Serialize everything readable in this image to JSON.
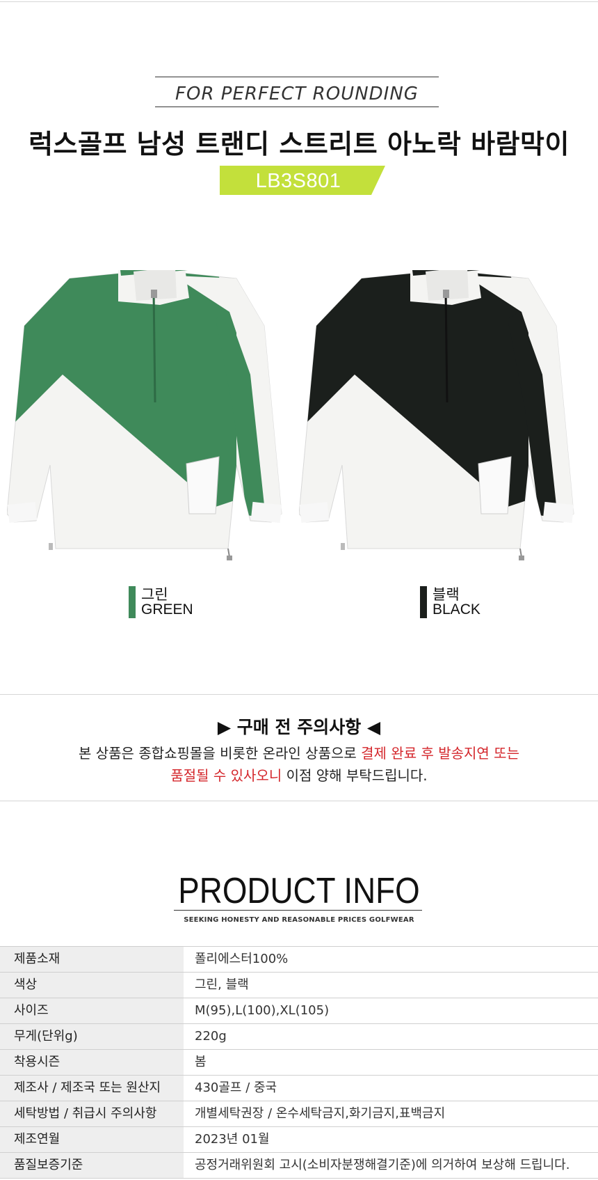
{
  "header": {
    "tagline": "FOR PERFECT ROUNDING",
    "title": "럭스골프 남성 트랜디 스트리트 아노락 바람막이",
    "product_code": "LB3S801",
    "badge_color": "#c3e03b"
  },
  "colors": [
    {
      "name_kr": "그린",
      "name_en": "GREEN",
      "swatch": "#3f8a5a"
    },
    {
      "name_kr": "블랙",
      "name_en": "BLACK",
      "swatch": "#1b1f1c"
    }
  ],
  "notice": {
    "title": "▶ 구매 전 주의사항 ◀",
    "line1_normal": "본 상품은 종합쇼핑몰을 비롯한 온라인 상품으로 ",
    "line1_red": "결제 완료 후 발송지연 또는",
    "line2_red": "품절될 수 있사오니",
    "line2_normal": " 이점 양해 부탁드립니다."
  },
  "product_info": {
    "title": "PRODUCT INFO",
    "subtitle": "SEEKING HONESTY AND REASONABLE PRICES GOLFWEAR",
    "rows": [
      {
        "label": "제품소재",
        "value": "폴리에스터100%"
      },
      {
        "label": "색상",
        "value": "그린, 블랙"
      },
      {
        "label": "사이즈",
        "value": "M(95),L(100),XL(105)"
      },
      {
        "label": "무게(단위g)",
        "value": "220g"
      },
      {
        "label": "착용시즌",
        "value": "봄"
      },
      {
        "label": "제조사 / 제조국 또는 원산지",
        "value": "430골프 / 중국"
      },
      {
        "label": "세탁방법 / 취급시 주의사항",
        "value": "개별세탁권장 / 온수세탁금지,화기금지,표백금지"
      },
      {
        "label": "제조연월",
        "value": "2023년 01월"
      },
      {
        "label": "품질보증기준",
        "value": "공정거래위원회 고시(소비자분쟁해결기준)에 의거하여  보상해 드립니다."
      }
    ]
  }
}
